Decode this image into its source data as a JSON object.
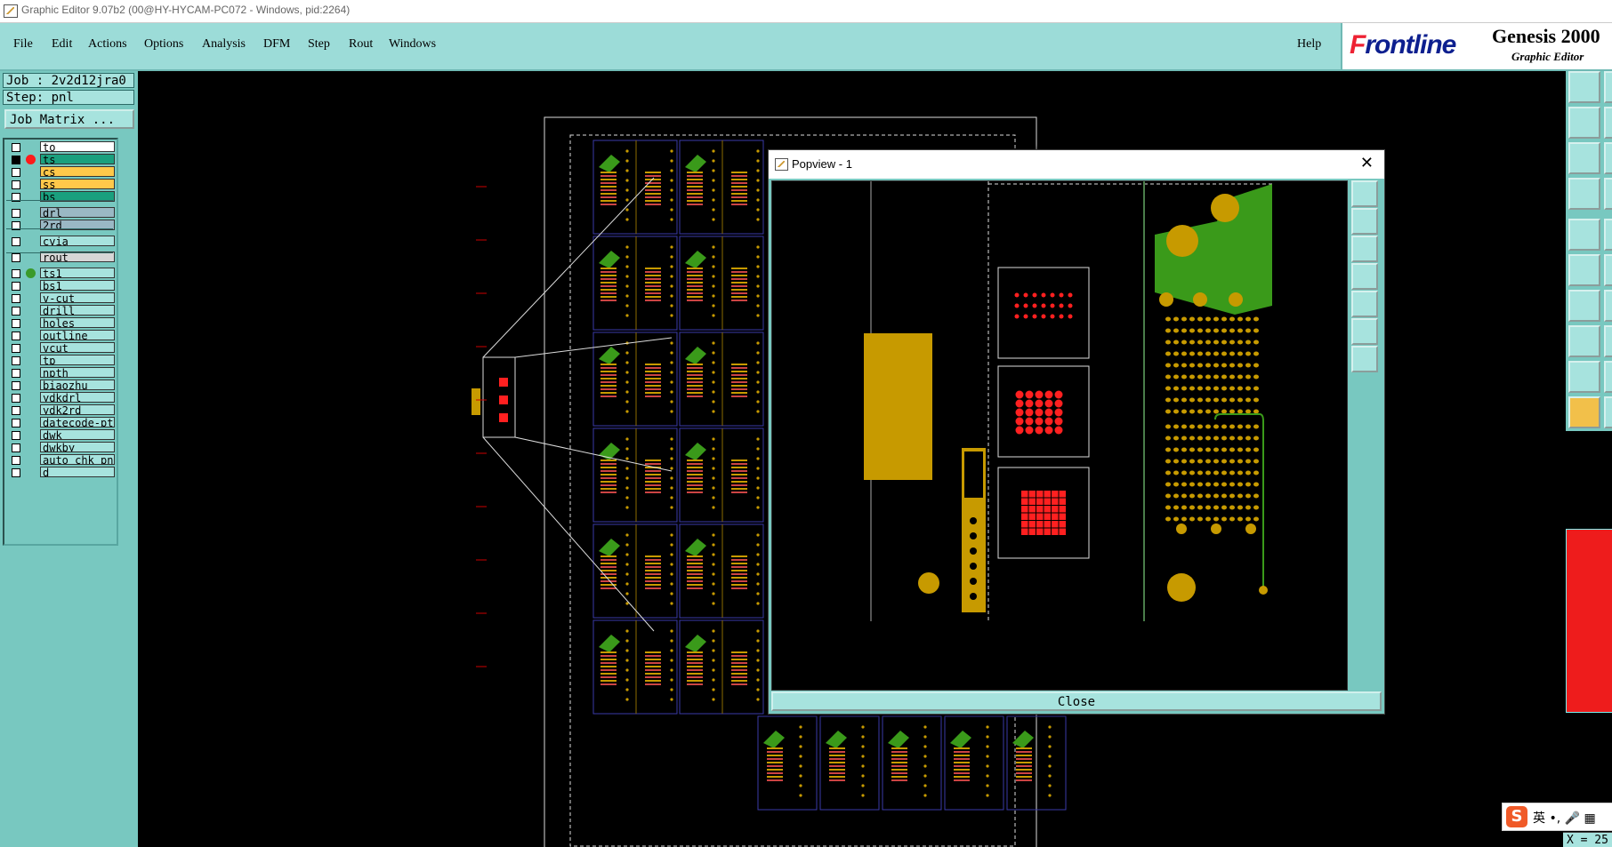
{
  "window": {
    "title": "Graphic Editor 9.07b2 (00@HY-HYCAM-PC072 - Windows, pid:2264)"
  },
  "menu": {
    "items": [
      "File",
      "Edit",
      "Actions",
      "Options",
      "Analysis",
      "DFM",
      "Step",
      "Rout",
      "Windows"
    ],
    "help": "Help"
  },
  "brand": {
    "logo": "Frontline",
    "product": "Genesis 2000",
    "subtitle": "Graphic Editor"
  },
  "job": {
    "job_label": "Job : 2v2d12jra0",
    "step_label": "Step: pnl",
    "matrix_button": "Job Matrix ..."
  },
  "layers": [
    {
      "name": "to",
      "color": "#ffffff",
      "checked": false,
      "dot": ""
    },
    {
      "name": "ts",
      "color": "#1aa07e",
      "checked": true,
      "dot": "#ff1a1a"
    },
    {
      "name": "cs",
      "color": "#ffc84a",
      "checked": false,
      "dot": ""
    },
    {
      "name": "ss",
      "color": "#ffc84a",
      "checked": false,
      "dot": ""
    },
    {
      "name": "bs",
      "color": "#1aa07e",
      "checked": false,
      "dot": ""
    },
    {
      "name": "drl",
      "color": "#9ab8c4",
      "checked": false,
      "dot": ""
    },
    {
      "name": "2rd",
      "color": "#9ab8c4",
      "checked": false,
      "dot": ""
    },
    {
      "name": "cvia",
      "color": "#a7e3de",
      "checked": false,
      "dot": ""
    },
    {
      "name": "rout",
      "color": "#d6d6d6",
      "checked": false,
      "dot": ""
    },
    {
      "name": "ts1",
      "color": "#a7e3de",
      "checked": false,
      "dot": "#3a9a2a"
    },
    {
      "name": "bs1",
      "color": "#a7e3de",
      "checked": false,
      "dot": ""
    },
    {
      "name": "v-cut",
      "color": "#a7e3de",
      "checked": false,
      "dot": ""
    },
    {
      "name": "drill",
      "color": "#a7e3de",
      "checked": false,
      "dot": ""
    },
    {
      "name": "holes",
      "color": "#a7e3de",
      "checked": false,
      "dot": ""
    },
    {
      "name": "outline",
      "color": "#a7e3de",
      "checked": false,
      "dot": ""
    },
    {
      "name": "vcut",
      "color": "#a7e3de",
      "checked": false,
      "dot": ""
    },
    {
      "name": "tp",
      "color": "#a7e3de",
      "checked": false,
      "dot": ""
    },
    {
      "name": "npth",
      "color": "#a7e3de",
      "checked": false,
      "dot": ""
    },
    {
      "name": "biaozhu",
      "color": "#a7e3de",
      "checked": false,
      "dot": ""
    },
    {
      "name": "ydkdrl",
      "color": "#a7e3de",
      "checked": false,
      "dot": ""
    },
    {
      "name": "ydk2rd",
      "color": "#a7e3de",
      "checked": false,
      "dot": ""
    },
    {
      "name": "datecode-pts",
      "color": "#a7e3de",
      "checked": false,
      "dot": ""
    },
    {
      "name": "dwk",
      "color": "#a7e3de",
      "checked": false,
      "dot": ""
    },
    {
      "name": "dwkby",
      "color": "#a7e3de",
      "checked": false,
      "dot": ""
    },
    {
      "name": "auto_chk_pnl",
      "color": "#a7e3de",
      "checked": false,
      "dot": ""
    },
    {
      "name": "d",
      "color": "#a7e3de",
      "checked": false,
      "dot": ""
    }
  ],
  "popview": {
    "title": "Popview - 1",
    "close_glyph": "✕",
    "close_label": "Close"
  },
  "ime": {
    "logo": "S",
    "text": "英 •, 🎤 ▦"
  },
  "status": {
    "coord": "X = 25"
  },
  "colors": {
    "panel": "#78c8c0",
    "panel_light": "#a7e3de",
    "copper": "#c79a00",
    "trace": "#3a9a1a",
    "pad": "#ff2020"
  }
}
